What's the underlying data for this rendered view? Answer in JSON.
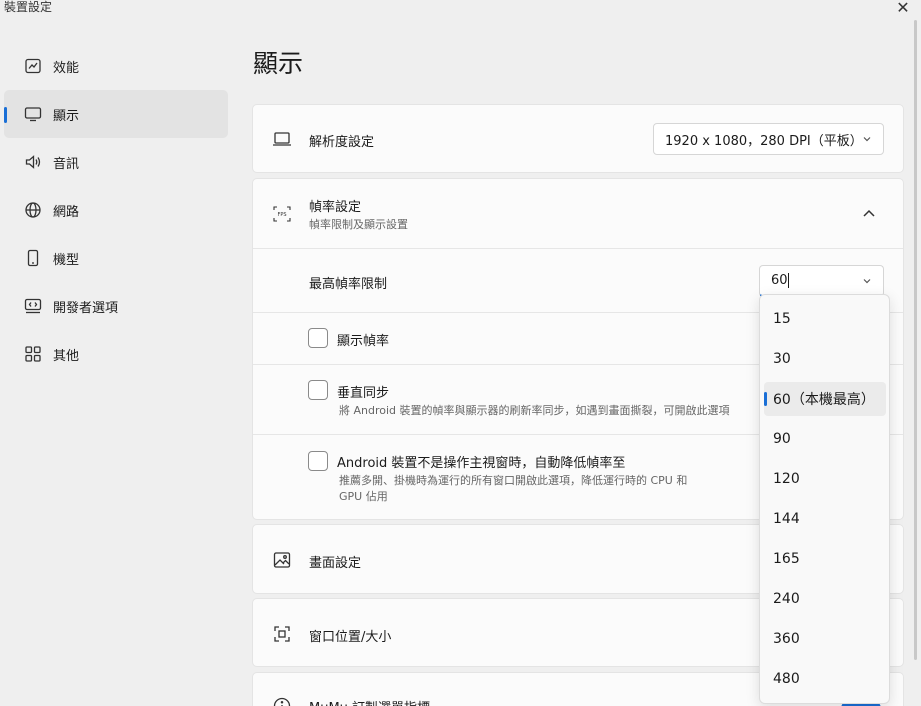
{
  "window": {
    "title": "裝置設定",
    "close_label": "✕"
  },
  "sidebar": {
    "items": [
      {
        "label": "效能",
        "icon": "performance-chart-icon"
      },
      {
        "label": "顯示",
        "icon": "monitor-icon",
        "active": true
      },
      {
        "label": "音訊",
        "icon": "speaker-icon"
      },
      {
        "label": "網路",
        "icon": "globe-icon"
      },
      {
        "label": "機型",
        "icon": "phone-icon"
      },
      {
        "label": "開發者選項",
        "icon": "code-monitor-icon"
      },
      {
        "label": "其他",
        "icon": "grid-icon"
      }
    ]
  },
  "main": {
    "title": "顯示",
    "resolution": {
      "label": "解析度設定",
      "value": "1920 x 1080，280 DPI（平板）"
    },
    "fps": {
      "label": "幀率設定",
      "sublabel": "幀率限制及顯示設置",
      "max_label": "最高幀率限制",
      "max_value": "60",
      "show_fps_label": "顯示幀率",
      "vsync_label": "垂直同步",
      "vsync_desc": "將 Android 裝置的幀率與顯示器的刷新率同步，如遇到畫面撕裂，可開啟此選項",
      "auto_lower_label": "Android 裝置不是操作主視窗時，自動降低幀率至",
      "auto_lower_desc_1": "推薦多開、掛機時為運行的所有窗口開啟此選項，降低運行時的 CPU 和",
      "auto_lower_desc_2": "GPU 佔用"
    },
    "picture": {
      "label": "畫面設定"
    },
    "window_pos": {
      "label": "窗口位置/大小"
    },
    "mumu": {
      "label": "MuMu 訂製選單指標"
    }
  },
  "dropdown": {
    "options": [
      "15",
      "30",
      "60（本機最高）",
      "90",
      "120",
      "144",
      "165",
      "240",
      "360",
      "480"
    ],
    "selected_index": 2
  },
  "colors": {
    "accent": "#1a6fd6",
    "background": "#efefef",
    "card": "#fbfbfb"
  }
}
